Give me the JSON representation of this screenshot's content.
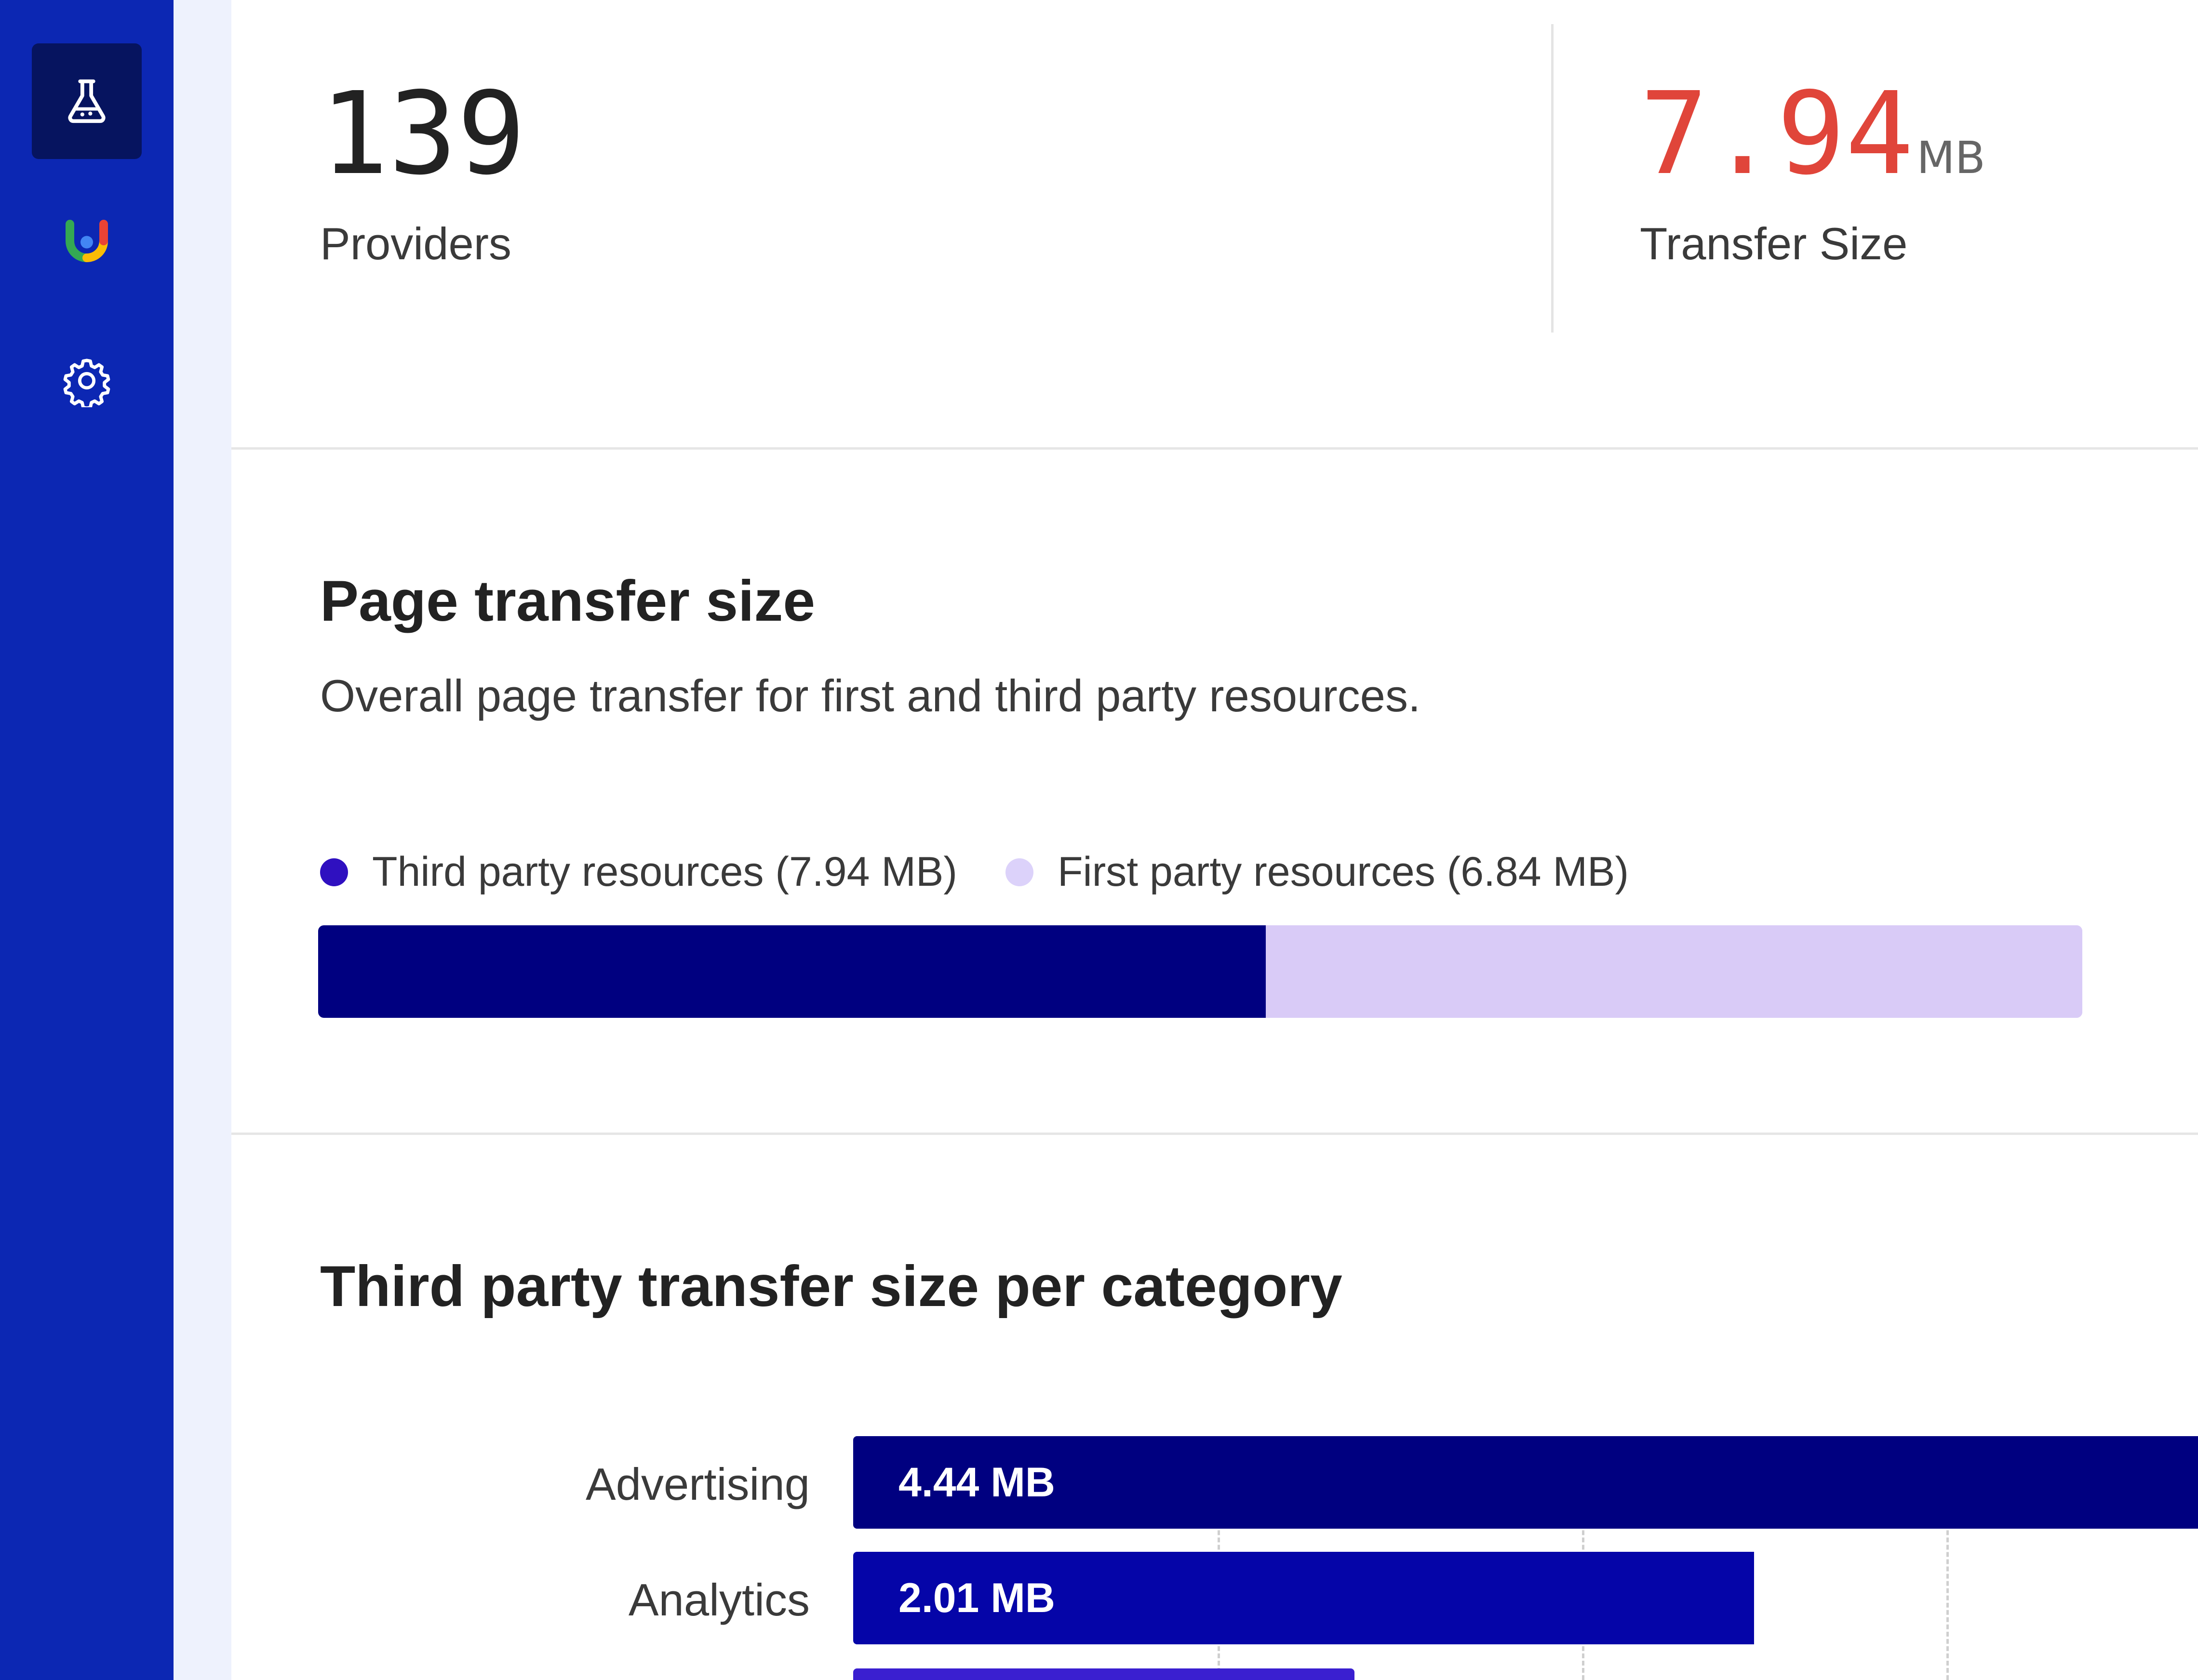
{
  "sidebar": {
    "items": [
      {
        "icon": "flask-icon",
        "active": true
      },
      {
        "icon": "app-logo-icon",
        "active": false
      },
      {
        "icon": "gear-icon",
        "active": false
      }
    ],
    "colors": {
      "background": "#0c27b3",
      "active": "#06145f"
    }
  },
  "stats": {
    "providers": {
      "value": "139",
      "label": "Providers"
    },
    "transfer": {
      "value": "7.94",
      "unit": "MB",
      "label": "Transfer Size",
      "color": "#e0453a"
    }
  },
  "page_transfer": {
    "title": "Page transfer size",
    "description": "Overall page transfer for first and third party resources.",
    "legend": [
      {
        "label": "Third party resources (7.94 MB)",
        "color": "#2f10c0"
      },
      {
        "label": "First party resources (6.84 MB)",
        "color": "#dcd2fa"
      }
    ]
  },
  "category_section": {
    "title": "Third party transfer size per category"
  },
  "chart_data": [
    {
      "type": "bar",
      "orientation": "horizontal-stacked",
      "categories": [
        "Page transfer"
      ],
      "series": [
        {
          "name": "Third party resources (7.94 MB)",
          "values": [
            7.94
          ],
          "color": "#000080"
        },
        {
          "name": "First party resources (6.84 MB)",
          "values": [
            6.84
          ],
          "color": "#d9cbf7"
        }
      ],
      "unit": "MB"
    },
    {
      "type": "bar",
      "orientation": "horizontal",
      "categories": [
        "Advertising",
        "Analytics"
      ],
      "values": [
        4.44,
        2.01
      ],
      "labels": [
        "4.44 MB",
        "2.01 MB"
      ],
      "colors": [
        "#000080",
        "#0505a8"
      ],
      "unit": "MB"
    }
  ]
}
